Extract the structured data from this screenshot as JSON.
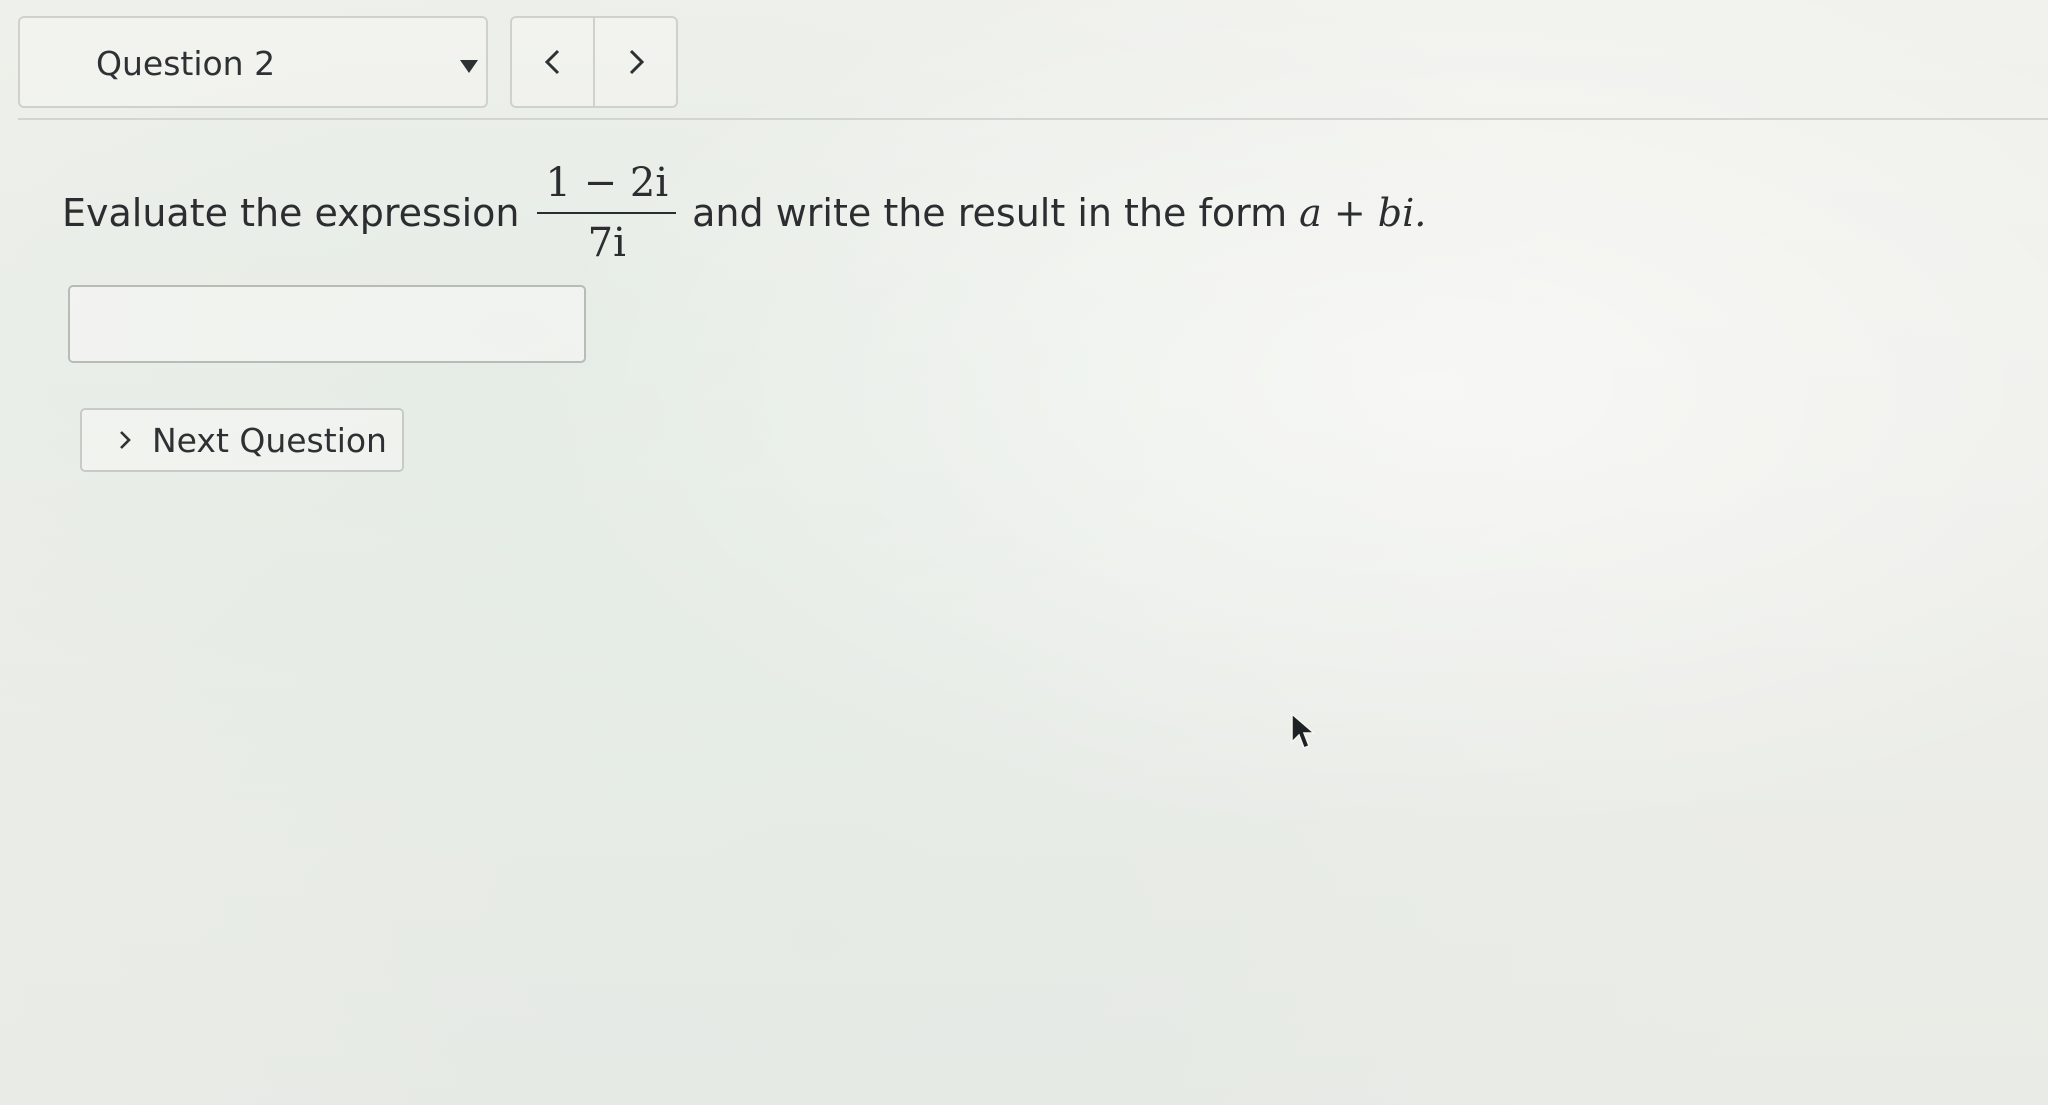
{
  "toolbar": {
    "question_label": "Question 2",
    "prev_icon": "chevron-left-icon",
    "next_icon": "chevron-right-icon",
    "dropdown_icon": "caret-down-icon"
  },
  "prompt": {
    "before": "Evaluate the expression",
    "numerator": "1 − 2i",
    "denominator": "7i",
    "after": "and write the result in the form",
    "form": "a + bi."
  },
  "answer": {
    "value": "",
    "placeholder": ""
  },
  "next_button": {
    "label": "Next Question",
    "icon": "chevron-right-icon"
  },
  "pointer": {
    "icon": "mouse-cursor-icon"
  }
}
